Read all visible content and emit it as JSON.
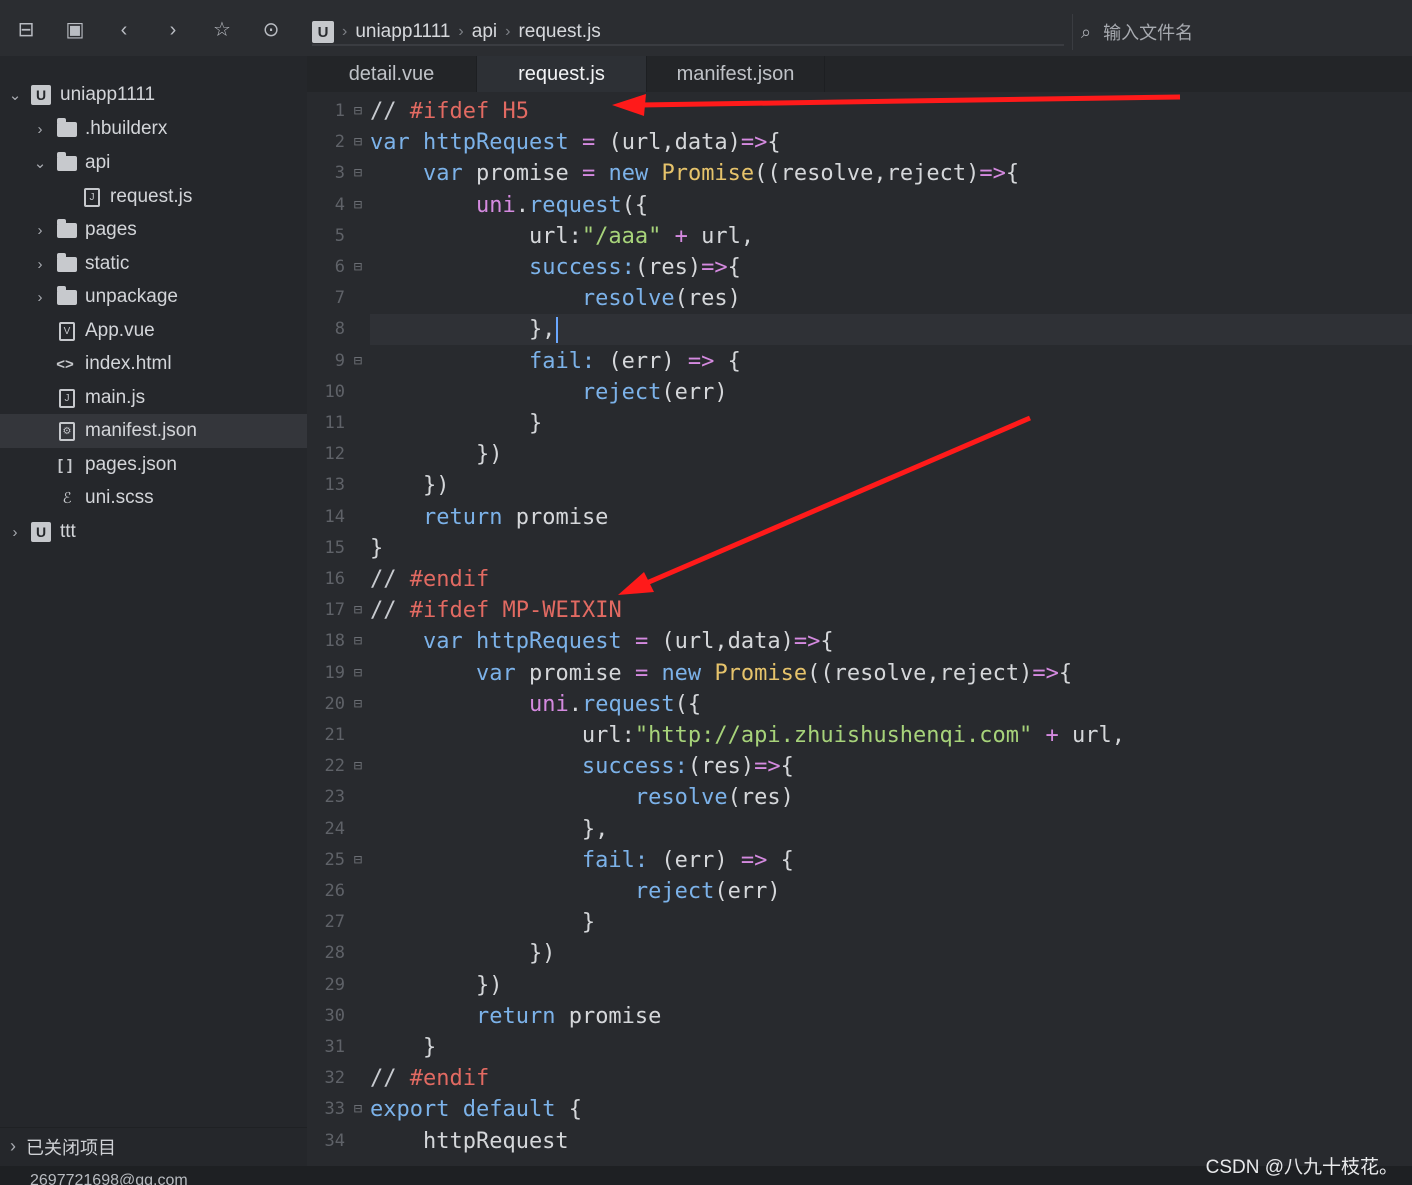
{
  "toolbar": {
    "icons": [
      "collapse-icon",
      "save-icon",
      "back-icon",
      "forward-icon",
      "star-icon",
      "run-icon"
    ],
    "breadcrumb": [
      "uniapp1111",
      "api",
      "request.js"
    ],
    "file_search_placeholder": "输入文件名"
  },
  "sidebar": {
    "items": [
      {
        "label": "uniapp1111",
        "type": "project",
        "expanded": true
      },
      {
        "label": ".hbuilderx",
        "type": "folder"
      },
      {
        "label": "api",
        "type": "folder",
        "expanded": true
      },
      {
        "label": "request.js",
        "type": "js-file"
      },
      {
        "label": "pages",
        "type": "folder"
      },
      {
        "label": "static",
        "type": "folder"
      },
      {
        "label": "unpackage",
        "type": "folder"
      },
      {
        "label": "App.vue",
        "type": "vue-file"
      },
      {
        "label": "index.html",
        "type": "html-file"
      },
      {
        "label": "main.js",
        "type": "js-file"
      },
      {
        "label": "manifest.json",
        "type": "settings-file",
        "selected": true
      },
      {
        "label": "pages.json",
        "type": "json-file"
      },
      {
        "label": "uni.scss",
        "type": "scss-file"
      },
      {
        "label": "ttt",
        "type": "project"
      }
    ],
    "closed_projects": "已关闭项目"
  },
  "tabs": [
    {
      "label": "detail.vue",
      "active": false
    },
    {
      "label": "request.js",
      "active": true
    },
    {
      "label": "manifest.json",
      "active": false
    }
  ],
  "editor": {
    "current_line": 8,
    "lines": [
      {
        "n": "1",
        "fold": "⊟",
        "tokens": [
          [
            "cm",
            "// "
          ],
          [
            "pp",
            "#ifdef"
          ],
          [
            "pu",
            " "
          ],
          [
            "pp",
            "H5"
          ]
        ]
      },
      {
        "n": "2",
        "fold": "⊟",
        "tokens": [
          [
            "kw",
            "var"
          ],
          [
            "pu",
            " "
          ],
          [
            "fn",
            "httpRequest"
          ],
          [
            "pu",
            " "
          ],
          [
            "op",
            "="
          ],
          [
            "pu",
            " (url,data)"
          ],
          [
            "op",
            "=>"
          ],
          [
            "pu",
            "{"
          ]
        ]
      },
      {
        "n": "3",
        "fold": "⊟",
        "tokens": [
          [
            "pu",
            "    "
          ],
          [
            "kw",
            "var"
          ],
          [
            "pu",
            " promise "
          ],
          [
            "op",
            "="
          ],
          [
            "pu",
            " "
          ],
          [
            "kw",
            "new"
          ],
          [
            "pu",
            " "
          ],
          [
            "ty",
            "Promise"
          ],
          [
            "pu",
            "((resolve,reject)"
          ],
          [
            "op",
            "=>"
          ],
          [
            "pu",
            "{"
          ]
        ]
      },
      {
        "n": "4",
        "fold": "⊟",
        "tokens": [
          [
            "pu",
            "        "
          ],
          [
            "op",
            "uni"
          ],
          [
            "pu",
            "."
          ],
          [
            "fn",
            "request"
          ],
          [
            "pu",
            "({"
          ]
        ]
      },
      {
        "n": "5",
        "fold": "",
        "tokens": [
          [
            "pu",
            "            url:"
          ],
          [
            "str",
            "\"/aaa\""
          ],
          [
            "pu",
            " "
          ],
          [
            "op",
            "+"
          ],
          [
            "pu",
            " url,"
          ]
        ]
      },
      {
        "n": "6",
        "fold": "⊟",
        "tokens": [
          [
            "pu",
            "            "
          ],
          [
            "fn",
            "success:"
          ],
          [
            "pu",
            "(res)"
          ],
          [
            "op",
            "=>"
          ],
          [
            "pu",
            "{"
          ]
        ]
      },
      {
        "n": "7",
        "fold": "",
        "tokens": [
          [
            "pu",
            "                "
          ],
          [
            "fn",
            "resolve"
          ],
          [
            "pu",
            "(res)"
          ]
        ]
      },
      {
        "n": "8",
        "fold": "",
        "tokens": [
          [
            "pu",
            "            },"
          ]
        ]
      },
      {
        "n": "9",
        "fold": "⊟",
        "tokens": [
          [
            "pu",
            "            "
          ],
          [
            "fn",
            "fail:"
          ],
          [
            "pu",
            " (err) "
          ],
          [
            "op",
            "=>"
          ],
          [
            "pu",
            " {"
          ]
        ]
      },
      {
        "n": "10",
        "fold": "",
        "tokens": [
          [
            "pu",
            "                "
          ],
          [
            "fn",
            "reject"
          ],
          [
            "pu",
            "(err)"
          ]
        ]
      },
      {
        "n": "11",
        "fold": "",
        "tokens": [
          [
            "pu",
            "            }"
          ]
        ]
      },
      {
        "n": "12",
        "fold": "",
        "tokens": [
          [
            "pu",
            "        })"
          ]
        ]
      },
      {
        "n": "13",
        "fold": "",
        "tokens": [
          [
            "pu",
            "    })"
          ]
        ]
      },
      {
        "n": "14",
        "fold": "",
        "tokens": [
          [
            "pu",
            "    "
          ],
          [
            "kw",
            "return"
          ],
          [
            "pu",
            " promise"
          ]
        ]
      },
      {
        "n": "15",
        "fold": "",
        "tokens": [
          [
            "pu",
            "}"
          ]
        ]
      },
      {
        "n": "16",
        "fold": "",
        "tokens": [
          [
            "cm",
            "// "
          ],
          [
            "pp",
            "#endif"
          ]
        ]
      },
      {
        "n": "17",
        "fold": "⊟",
        "tokens": [
          [
            "cm",
            "// "
          ],
          [
            "pp",
            "#ifdef"
          ],
          [
            "pu",
            " "
          ],
          [
            "pp",
            "MP-WEIXIN"
          ]
        ]
      },
      {
        "n": "18",
        "fold": "⊟",
        "tokens": [
          [
            "pu",
            "    "
          ],
          [
            "kw",
            "var"
          ],
          [
            "pu",
            " "
          ],
          [
            "fn",
            "httpRequest"
          ],
          [
            "pu",
            " "
          ],
          [
            "op",
            "="
          ],
          [
            "pu",
            " (url,data)"
          ],
          [
            "op",
            "=>"
          ],
          [
            "pu",
            "{"
          ]
        ]
      },
      {
        "n": "19",
        "fold": "⊟",
        "tokens": [
          [
            "pu",
            "        "
          ],
          [
            "kw",
            "var"
          ],
          [
            "pu",
            " promise "
          ],
          [
            "op",
            "="
          ],
          [
            "pu",
            " "
          ],
          [
            "kw",
            "new"
          ],
          [
            "pu",
            " "
          ],
          [
            "ty",
            "Promise"
          ],
          [
            "pu",
            "((resolve,reject)"
          ],
          [
            "op",
            "=>"
          ],
          [
            "pu",
            "{"
          ]
        ]
      },
      {
        "n": "20",
        "fold": "⊟",
        "tokens": [
          [
            "pu",
            "            "
          ],
          [
            "op",
            "uni"
          ],
          [
            "pu",
            "."
          ],
          [
            "fn",
            "request"
          ],
          [
            "pu",
            "({"
          ]
        ]
      },
      {
        "n": "21",
        "fold": "",
        "tokens": [
          [
            "pu",
            "                url:"
          ],
          [
            "str",
            "\"http://api.zhuishushenqi.com\""
          ],
          [
            "pu",
            " "
          ],
          [
            "op",
            "+"
          ],
          [
            "pu",
            " url,"
          ]
        ]
      },
      {
        "n": "22",
        "fold": "⊟",
        "tokens": [
          [
            "pu",
            "                "
          ],
          [
            "fn",
            "success:"
          ],
          [
            "pu",
            "(res)"
          ],
          [
            "op",
            "=>"
          ],
          [
            "pu",
            "{"
          ]
        ]
      },
      {
        "n": "23",
        "fold": "",
        "tokens": [
          [
            "pu",
            "                    "
          ],
          [
            "fn",
            "resolve"
          ],
          [
            "pu",
            "(res)"
          ]
        ]
      },
      {
        "n": "24",
        "fold": "",
        "tokens": [
          [
            "pu",
            "                },"
          ]
        ]
      },
      {
        "n": "25",
        "fold": "⊟",
        "tokens": [
          [
            "pu",
            "                "
          ],
          [
            "fn",
            "fail:"
          ],
          [
            "pu",
            " (err) "
          ],
          [
            "op",
            "=>"
          ],
          [
            "pu",
            " {"
          ]
        ]
      },
      {
        "n": "26",
        "fold": "",
        "tokens": [
          [
            "pu",
            "                    "
          ],
          [
            "fn",
            "reject"
          ],
          [
            "pu",
            "(err)"
          ]
        ]
      },
      {
        "n": "27",
        "fold": "",
        "tokens": [
          [
            "pu",
            "                }"
          ]
        ]
      },
      {
        "n": "28",
        "fold": "",
        "tokens": [
          [
            "pu",
            "            })"
          ]
        ]
      },
      {
        "n": "29",
        "fold": "",
        "tokens": [
          [
            "pu",
            "        })"
          ]
        ]
      },
      {
        "n": "30",
        "fold": "",
        "tokens": [
          [
            "pu",
            "        "
          ],
          [
            "kw",
            "return"
          ],
          [
            "pu",
            " promise"
          ]
        ]
      },
      {
        "n": "31",
        "fold": "",
        "tokens": [
          [
            "pu",
            "    }"
          ]
        ]
      },
      {
        "n": "32",
        "fold": "",
        "tokens": [
          [
            "cm",
            "// "
          ],
          [
            "pp",
            "#endif"
          ]
        ]
      },
      {
        "n": "33",
        "fold": "⊟",
        "tokens": [
          [
            "kw",
            "export"
          ],
          [
            "pu",
            " "
          ],
          [
            "kw",
            "default"
          ],
          [
            "pu",
            " {"
          ]
        ]
      },
      {
        "n": "34",
        "fold": "",
        "tokens": [
          [
            "pu",
            "    httpRequest"
          ]
        ]
      }
    ]
  },
  "statusbar": {
    "account": "2697721698@qq.com"
  },
  "watermark": "CSDN @八九十枝花。",
  "colors": {
    "arrow": "#ff1a1a",
    "keyword": "#7cb2e9",
    "preprocessor": "#e26a62",
    "string": "#a7d37a",
    "type": "#e6c36b",
    "operator": "#d58ae0"
  }
}
